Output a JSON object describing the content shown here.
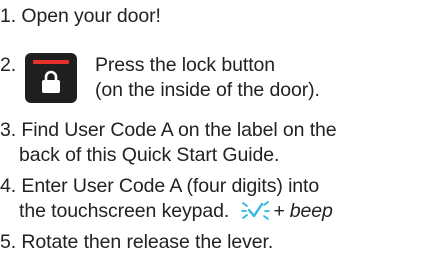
{
  "steps": [
    {
      "number": "1.",
      "lines": [
        "Open your door!"
      ]
    },
    {
      "number": "2.",
      "lines": [
        "Press the lock button",
        "(on the inside of the door)."
      ]
    },
    {
      "number": "3.",
      "lines": [
        "Find User Code A on the label on the",
        "back of this Quick Start Guide."
      ]
    },
    {
      "number": "4.",
      "lines": [
        "Enter User Code A (four digits) into",
        "the touchscreen keypad."
      ],
      "feedback": "+ beep"
    },
    {
      "number": "5.",
      "lines": [
        "Rotate then release the lever."
      ]
    }
  ],
  "icons": {
    "lock_button": "lock-icon",
    "success_indicator": "checkmark-sparkle-icon"
  },
  "colors": {
    "lock_button_body": "#1f1f1f",
    "lock_button_bar": "#e8302c",
    "sparkle": "#35b8e0"
  }
}
